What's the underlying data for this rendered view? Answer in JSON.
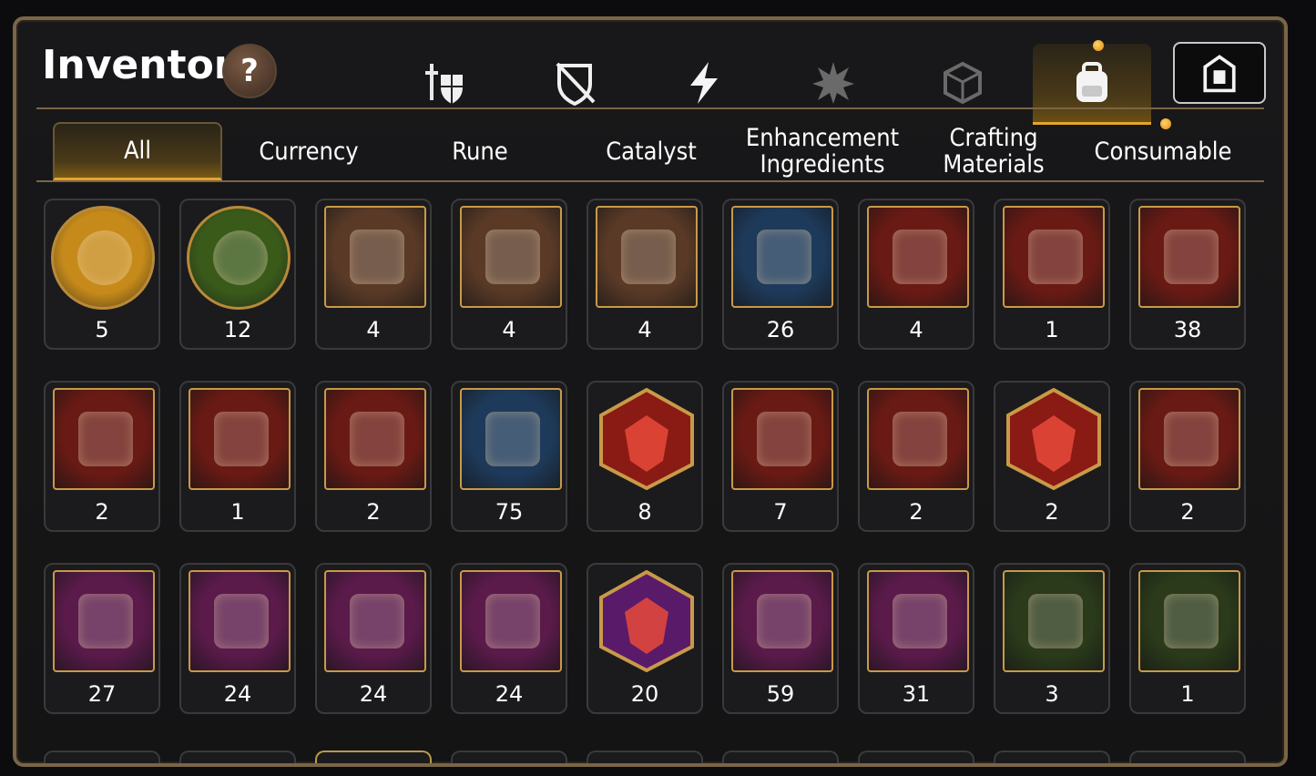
{
  "header": {
    "title": "Inventory",
    "help_label": "?"
  },
  "top_tabs": [
    {
      "name": "equipment-tab",
      "icon": "sword-shield-icon",
      "active": false
    },
    {
      "name": "disabled-gear-tab",
      "icon": "crossed-shield-icon",
      "active": false
    },
    {
      "name": "skill-tab",
      "icon": "lightning-icon",
      "active": false
    },
    {
      "name": "burst-tab",
      "icon": "burst-icon",
      "active": false
    },
    {
      "name": "cube-tab",
      "icon": "cube-icon",
      "active": false
    },
    {
      "name": "bag-tab",
      "icon": "backpack-icon",
      "active": true
    }
  ],
  "sub_tabs": [
    {
      "label": "All",
      "active": true
    },
    {
      "label": "Currency",
      "active": false
    },
    {
      "label": "Rune",
      "active": false
    },
    {
      "label": "Catalyst",
      "active": false
    },
    {
      "label": "Enhancement\nIngredients",
      "active": false
    },
    {
      "label": "Crafting\nMaterials",
      "active": false
    },
    {
      "label": "Consumable",
      "active": false
    }
  ],
  "items": [
    [
      {
        "icon": "chick-coin-icon",
        "count": "5",
        "frame": "round",
        "bg": "#c68a1a"
      },
      {
        "icon": "chick-coin-green-icon",
        "count": "12",
        "frame": "round",
        "bg": "#3a5a1a"
      },
      {
        "icon": "scroll-upgrade-icon",
        "count": "4",
        "frame": "square",
        "bg": "#5a3a26"
      },
      {
        "icon": "rainbow-scroll-icon",
        "count": "4",
        "frame": "square",
        "bg": "#5a3a26"
      },
      {
        "icon": "scroll-upgrade-icon",
        "count": "4",
        "frame": "square",
        "bg": "#5a3a26"
      },
      {
        "icon": "gold-crystal-icon",
        "count": "26",
        "frame": "square",
        "bg": "#1e3a5a"
      },
      {
        "icon": "red-potion-icon",
        "count": "4",
        "frame": "square",
        "bg": "#6a1a14"
      },
      {
        "icon": "star-wand-icon",
        "count": "1",
        "frame": "square",
        "bg": "#6a1a14"
      },
      {
        "icon": "silver-chest-icon",
        "count": "38",
        "frame": "square",
        "bg": "#6a1a14"
      }
    ],
    [
      {
        "icon": "blue-chest-icon",
        "count": "2",
        "frame": "square",
        "bg": "#6a1a14"
      },
      {
        "icon": "black-chest-icon",
        "count": "1",
        "frame": "square",
        "bg": "#6a1a14"
      },
      {
        "icon": "black-chest-icon",
        "count": "2",
        "frame": "square",
        "bg": "#6a1a14"
      },
      {
        "icon": "steel-cube-icon",
        "count": "75",
        "frame": "square",
        "bg": "#1e3a5a"
      },
      {
        "icon": "red-sparkle-stone-icon",
        "count": "8",
        "frame": "hex",
        "bg": "#8a1a14"
      },
      {
        "icon": "red-hammer-stone-icon",
        "count": "7",
        "frame": "square",
        "bg": "#6a1a14"
      },
      {
        "icon": "red-bar-stone-icon",
        "count": "2",
        "frame": "square",
        "bg": "#6a1a14"
      },
      {
        "icon": "pink-potion-icon",
        "count": "2",
        "frame": "hex",
        "bg": "#8a1a14"
      },
      {
        "icon": "blue-hammer-stone-icon",
        "count": "2",
        "frame": "square",
        "bg": "#6a1a14"
      }
    ],
    [
      {
        "icon": "sword-rune-icon",
        "count": "27",
        "frame": "square",
        "bg": "#5a1a4a"
      },
      {
        "icon": "spiral-rune-icon",
        "count": "24",
        "frame": "square",
        "bg": "#5a1a4a"
      },
      {
        "icon": "bell-rune-icon",
        "count": "24",
        "frame": "square",
        "bg": "#5a1a4a"
      },
      {
        "icon": "boot-rune-icon",
        "count": "24",
        "frame": "square",
        "bg": "#5a1a4a"
      },
      {
        "icon": "sparkle-rune-icon",
        "count": "20",
        "frame": "hex",
        "bg": "#5a1a6a"
      },
      {
        "icon": "hammer-rune-icon",
        "count": "59",
        "frame": "square",
        "bg": "#5a1a4a"
      },
      {
        "icon": "bar-rune-icon",
        "count": "31",
        "frame": "square",
        "bg": "#5a1a4a"
      },
      {
        "icon": "stone-sword-rune-icon",
        "count": "3",
        "frame": "square",
        "bg": "#2a3a1a"
      },
      {
        "icon": "stone-spiral-rune-icon",
        "count": "1",
        "frame": "square",
        "bg": "#2a3a1a"
      }
    ]
  ],
  "colors": {
    "accent": "#e4a52a",
    "frame": "#7a6546"
  }
}
